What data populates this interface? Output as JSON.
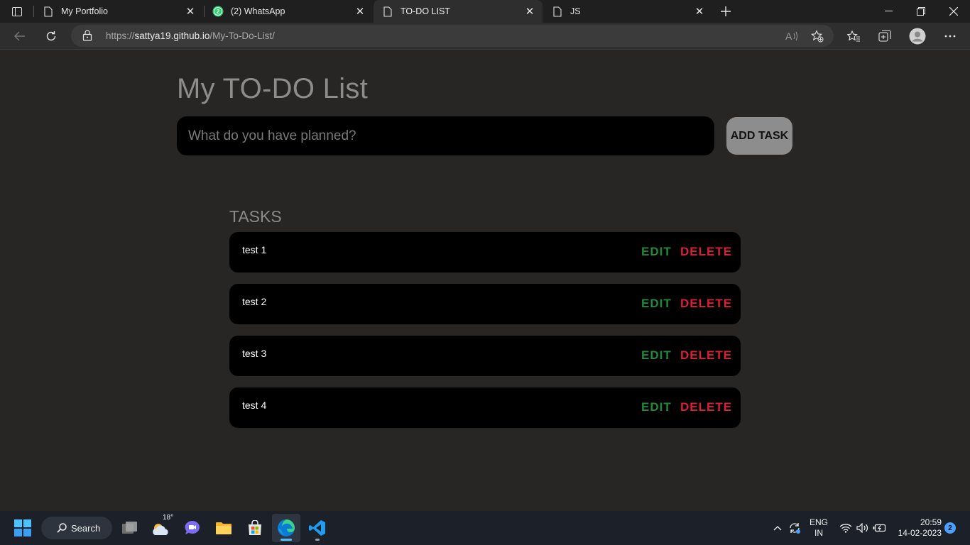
{
  "browser": {
    "tabs": [
      {
        "title": "My Portfolio",
        "favicon": "page-icon",
        "active": false
      },
      {
        "title": "(2) WhatsApp",
        "favicon": "whatsapp-icon",
        "badge": "2",
        "active": false
      },
      {
        "title": "TO-DO LIST",
        "favicon": "page-icon",
        "active": true
      },
      {
        "title": "JS",
        "favicon": "page-icon",
        "active": false
      }
    ],
    "address": {
      "scheme": "https://",
      "host": "sattya19.github.io",
      "path": "/My-To-Do-List/"
    },
    "icons": [
      "back-icon",
      "refresh-icon",
      "lock-icon",
      "read-aloud-icon",
      "add-favorite-icon",
      "favorites-icon",
      "collections-icon",
      "profile-icon",
      "more-icon"
    ]
  },
  "app": {
    "title": "My TO-DO List",
    "input_placeholder": "What do you have planned?",
    "add_button": "ADD TASK",
    "tasks_heading": "TASKS",
    "edit_label": "EDIT",
    "delete_label": "DELETE",
    "tasks": [
      "test 1",
      "test 2",
      "test 3",
      "test 4"
    ],
    "colors": {
      "edit": "#1f8a3a",
      "delete": "#dc1f37",
      "background": "#272625",
      "card": "#000000"
    }
  },
  "taskbar": {
    "search_label": "Search",
    "weather_temp": "18°",
    "language": {
      "line1": "ENG",
      "line2": "IN"
    },
    "clock": {
      "time": "20:59",
      "date": "14-02-2023"
    },
    "notification_count": "2",
    "apps": [
      "start-icon",
      "task-view-icon",
      "weather-icon",
      "chat-icon",
      "file-explorer-icon",
      "store-icon",
      "edge-icon",
      "vscode-icon"
    ]
  }
}
